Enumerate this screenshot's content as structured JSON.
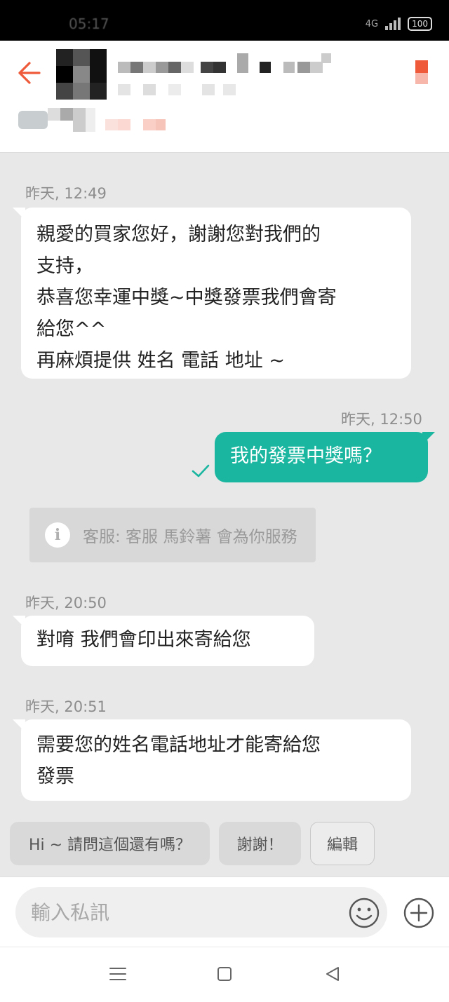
{
  "status_bar": {
    "time": "05:17",
    "network": "4G",
    "battery": "100"
  },
  "header": {
    "back_icon": "arrow-left-icon",
    "menu_icon": "more-icon",
    "accent_color": "#ee5a3a"
  },
  "messages": [
    {
      "timestamp": "昨天, 12:49",
      "direction": "incoming",
      "lines": [
        "親愛的買家您好，謝謝您對我們的",
        "支持，",
        "恭喜您幸運中獎~中獎發票我們會寄",
        "給您^^",
        "再麻煩提供  姓名 電話 地址 ~"
      ]
    },
    {
      "timestamp": "昨天, 12:50",
      "direction": "outgoing",
      "lines": [
        "我的發票中獎嗎？"
      ],
      "status_icon": "check-icon"
    },
    {
      "timestamp": "昨天, 20:50",
      "direction": "incoming",
      "lines": [
        "對唷  我們會印出來寄給您"
      ]
    },
    {
      "timestamp": "昨天, 20:51",
      "direction": "incoming",
      "lines": [
        "需要您的姓名電話地址才能寄給您",
        "發票"
      ]
    }
  ],
  "system_notice": {
    "icon": "info-icon",
    "icon_glyph": "i",
    "text": "客服: 客服 馬鈴薯 會為你服務"
  },
  "quick_replies": [
    "Hi ~ 請問這個還有嗎？",
    "謝謝！",
    "編輯"
  ],
  "input": {
    "placeholder": "輸入私訊",
    "emoji_icon": "smiley-icon",
    "add_icon": "plus-circle-icon"
  },
  "nav_bar": {
    "buttons": [
      "menu-icon",
      "home-icon",
      "back-icon"
    ]
  },
  "colors": {
    "outgoing_bubble": "#1ab6a0",
    "incoming_bubble": "#ffffff",
    "chat_background": "#e8e8e8",
    "accent": "#ee5a3a"
  }
}
